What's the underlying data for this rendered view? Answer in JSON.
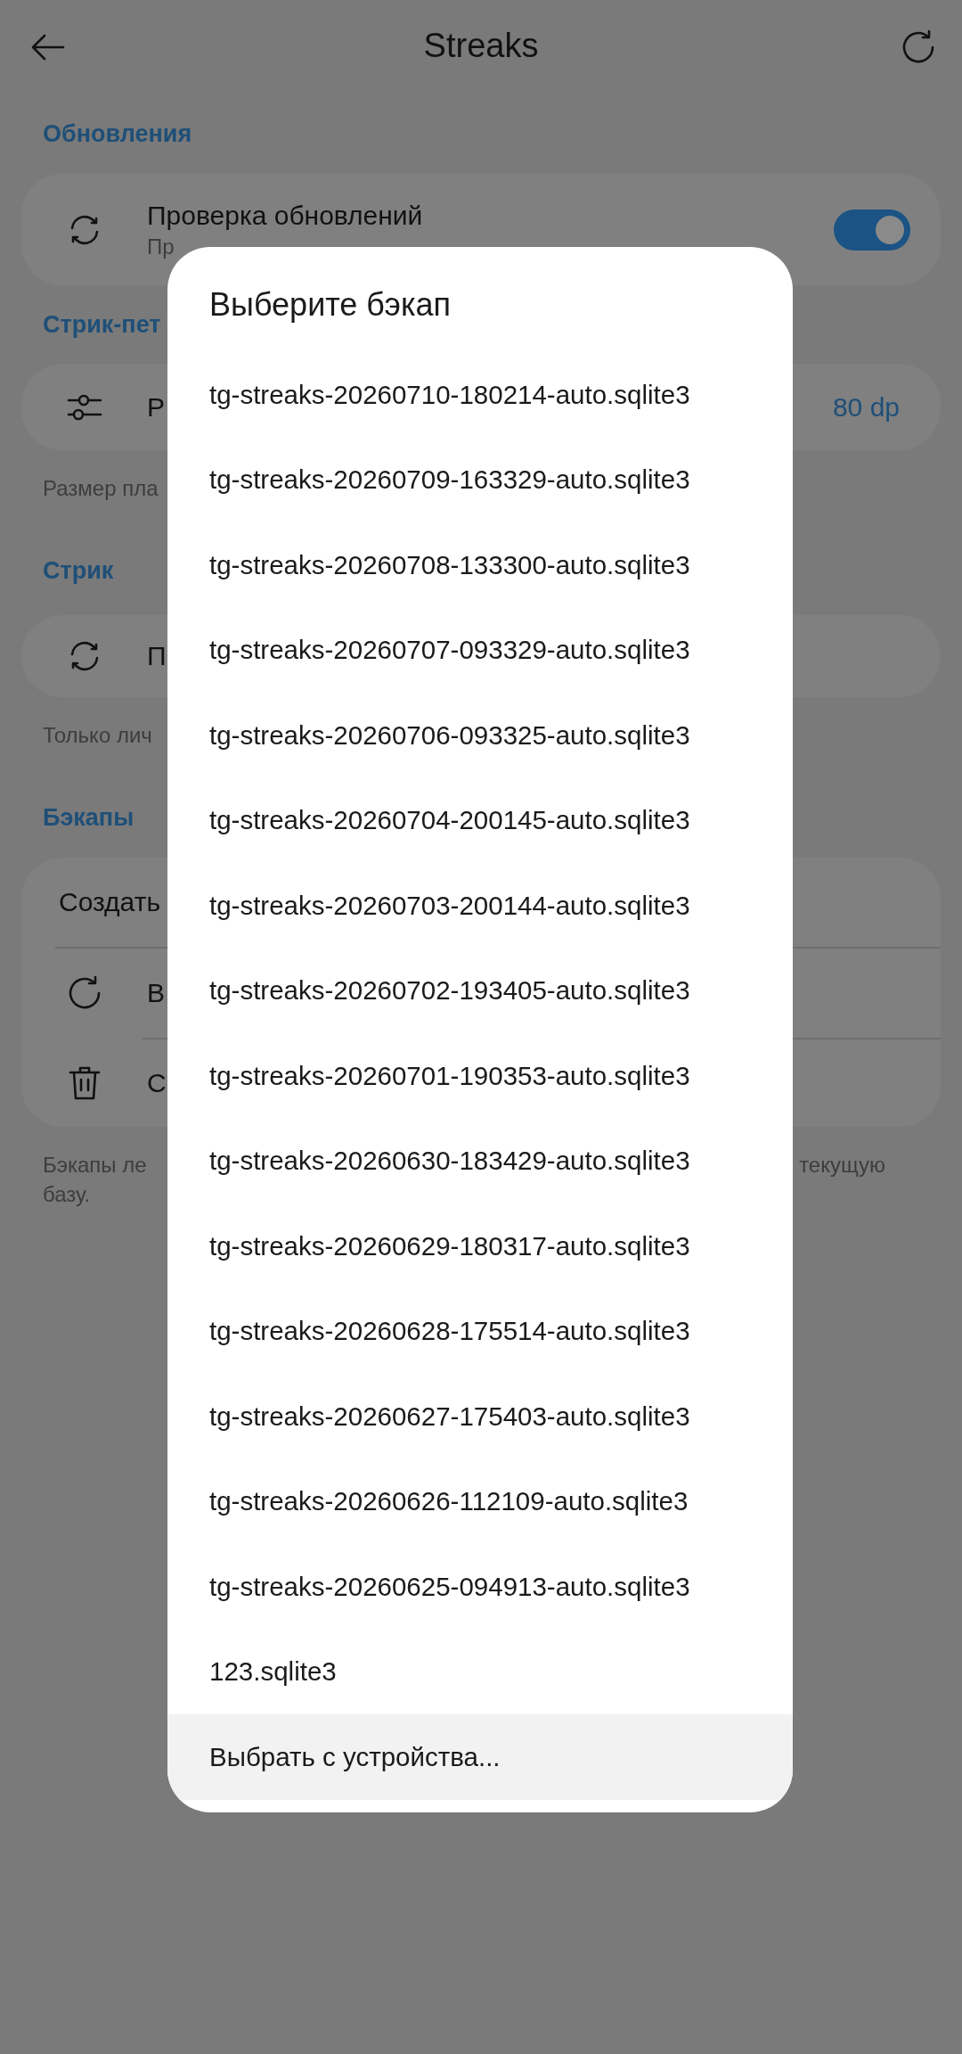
{
  "top_bar": {
    "title": "Streaks"
  },
  "sections": [
    {
      "header": "Обновления",
      "rows": [
        {
          "kind": "toggle",
          "title": "Проверка обновлений",
          "subtitle": "Пр",
          "on": true
        }
      ]
    },
    {
      "header": "Стрик-пет",
      "rows": [
        {
          "kind": "value",
          "title": "Р",
          "value": "80 dp"
        }
      ],
      "footer": [
        "Размер пла"
      ]
    },
    {
      "header": "Стрик",
      "rows": [
        {
          "kind": "plain",
          "title": "П"
        }
      ],
      "footer": [
        "Только лич"
      ]
    },
    {
      "header": "Бэкапы",
      "rows": [
        {
          "kind": "plain",
          "title": "Создать"
        },
        {
          "kind": "plain",
          "title": "В"
        },
        {
          "kind": "plain",
          "title": "С"
        }
      ],
      "footer": [
        "Бэкапы ле",
        "базу."
      ],
      "footer_tail": "текущую"
    }
  ],
  "dialog": {
    "title": "Выберите бэкап",
    "items": [
      {
        "kind": "file",
        "label": "tg-streaks-20260710-180214-auto.sqlite3"
      },
      {
        "kind": "file",
        "label": "tg-streaks-20260709-163329-auto.sqlite3"
      },
      {
        "kind": "file",
        "label": "tg-streaks-20260708-133300-auto.sqlite3"
      },
      {
        "kind": "file",
        "label": "tg-streaks-20260707-093329-auto.sqlite3"
      },
      {
        "kind": "file",
        "label": "tg-streaks-20260706-093325-auto.sqlite3"
      },
      {
        "kind": "file",
        "label": "tg-streaks-20260704-200145-auto.sqlite3"
      },
      {
        "kind": "file",
        "label": "tg-streaks-20260703-200144-auto.sqlite3"
      },
      {
        "kind": "file",
        "label": "tg-streaks-20260702-193405-auto.sqlite3"
      },
      {
        "kind": "file",
        "label": "tg-streaks-20260701-190353-auto.sqlite3"
      },
      {
        "kind": "file",
        "label": "tg-streaks-20260630-183429-auto.sqlite3"
      },
      {
        "kind": "file",
        "label": "tg-streaks-20260629-180317-auto.sqlite3"
      },
      {
        "kind": "file",
        "label": "tg-streaks-20260628-175514-auto.sqlite3"
      },
      {
        "kind": "file",
        "label": "tg-streaks-20260627-175403-auto.sqlite3"
      },
      {
        "kind": "file",
        "label": "tg-streaks-20260626-112109-auto.sqlite3"
      },
      {
        "kind": "file",
        "label": "tg-streaks-20260625-094913-auto.sqlite3"
      },
      {
        "kind": "file",
        "label": "123.sqlite3"
      },
      {
        "kind": "action",
        "label": "Выбрать с устройства..."
      }
    ]
  }
}
